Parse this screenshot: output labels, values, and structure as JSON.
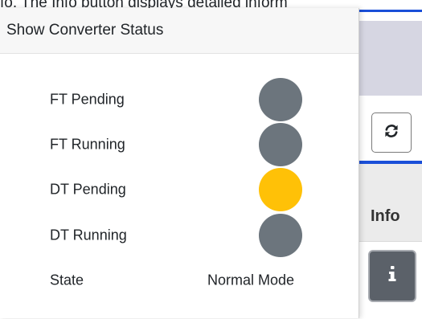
{
  "background": {
    "top_text": "fo. The Info button displays detailed inform",
    "info_column_header": "Info",
    "refresh_icon": "refresh-icon",
    "info_icon": "info-icon"
  },
  "popover": {
    "title": "Show Converter Status",
    "rows": [
      {
        "label": "FT Pending",
        "indicator_color": "#6c757d",
        "status": "inactive"
      },
      {
        "label": "FT Running",
        "indicator_color": "#6c757d",
        "status": "inactive"
      },
      {
        "label": "DT Pending",
        "indicator_color": "#ffc107",
        "status": "active"
      },
      {
        "label": "DT Running",
        "indicator_color": "#6c757d",
        "status": "inactive"
      }
    ],
    "state": {
      "label": "State",
      "value": "Normal Mode"
    }
  }
}
